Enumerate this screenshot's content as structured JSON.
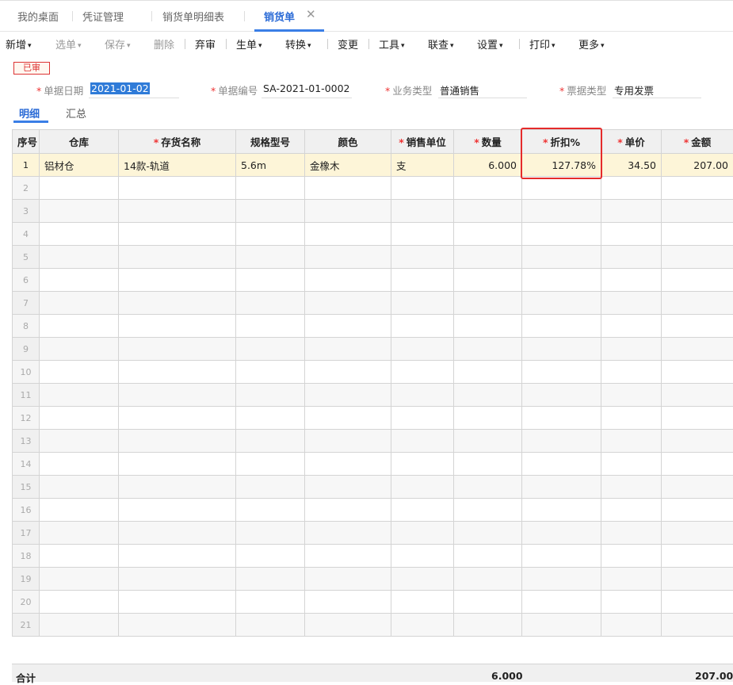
{
  "tabs": [
    {
      "label": "我的桌面"
    },
    {
      "label": "凭证管理"
    },
    {
      "label": "销货单明细表"
    },
    {
      "label": "销货单"
    }
  ],
  "tab_close_glyph": "✕",
  "toolbar": {
    "new": "新增",
    "select": "选单",
    "save": "保存",
    "delete": "删除",
    "unaudit": "弃审",
    "generate": "生单",
    "convert": "转换",
    "change": "变更",
    "tools": "工具",
    "link": "联查",
    "settings": "设置",
    "print": "打印",
    "more": "更多"
  },
  "status_badge": "已审",
  "form": {
    "date_label": "单据日期",
    "date_value": "2021-01-02",
    "no_label": "单据编号",
    "no_value": "SA-2021-01-0002",
    "biz_label": "业务类型",
    "biz_value": "普通销售",
    "inv_label": "票据类型",
    "inv_value": "专用发票"
  },
  "subtabs": {
    "detail": "明细",
    "summary": "汇总"
  },
  "table": {
    "headers": [
      "序号",
      "仓库",
      "存货名称",
      "规格型号",
      "颜色",
      "销售单位",
      "数量",
      "折扣%",
      "单价",
      "金额"
    ],
    "required_mark": "*",
    "row1": {
      "idx": "1",
      "warehouse": "铝材仓",
      "item": "14款-轨道",
      "spec": "5.6m",
      "color": "金橡木",
      "unit": "支",
      "qty": "6.000",
      "discount": "127.78%",
      "price": "34.50",
      "amount": "207.00"
    },
    "empty_rows": [
      "2",
      "3",
      "4",
      "5",
      "6",
      "7",
      "8",
      "9",
      "10",
      "11",
      "12",
      "13",
      "14",
      "15",
      "16",
      "17",
      "18",
      "19",
      "20",
      "21"
    ]
  },
  "footer": {
    "label": "合计",
    "qty_total": "6.000",
    "amount_total": "207.00"
  },
  "colors": {
    "accent": "#3a7ee6",
    "highlight": "#e52b2b",
    "selected_row": "#fdf5d8"
  }
}
